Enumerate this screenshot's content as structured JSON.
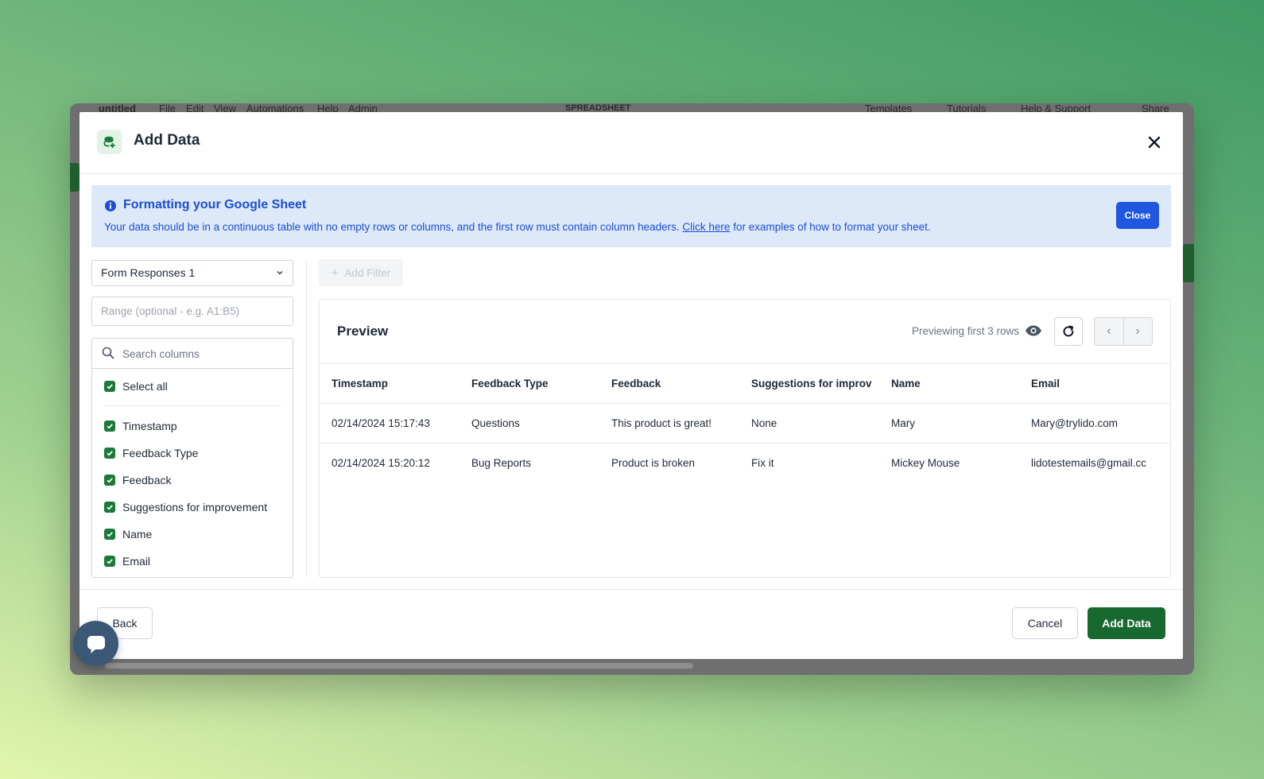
{
  "app": {
    "doc_title": "untitled",
    "menu": [
      "File",
      "Edit",
      "View",
      "Automations",
      "Help",
      "Admin"
    ],
    "mode_label": "SPREADSHEET",
    "right_menu": [
      "Templates",
      "Tutorials",
      "Help & Support",
      "Share"
    ]
  },
  "modal": {
    "title": "Add Data",
    "icon": "database-add-icon",
    "close_icon": "close-icon"
  },
  "banner": {
    "title": "Formatting your Google Sheet",
    "body_before": "Your data should be in a continuous table with no empty rows or columns, and the first row must contain column headers.",
    "link_text": "Click here",
    "body_after": "for examples of how to format your sheet.",
    "close_label": "Close"
  },
  "left_panel": {
    "sheet_value": "Form Responses 1",
    "range_placeholder": "Range (optional - e.g. A1:B5)",
    "search_placeholder": "Search columns",
    "select_all_label": "Select all",
    "columns": [
      "Timestamp",
      "Feedback Type",
      "Feedback",
      "Suggestions for improvement",
      "Name",
      "Email"
    ]
  },
  "filter": {
    "add_filter_label": "Add Filter"
  },
  "preview": {
    "title": "Preview",
    "count_text": "Previewing first 3 rows",
    "headers": [
      "Timestamp",
      "Feedback Type",
      "Feedback",
      "Suggestions for improv",
      "Name",
      "Email"
    ],
    "rows": [
      [
        "02/14/2024 15:17:43",
        "Questions",
        "This product is great!",
        "None",
        "Mary",
        "Mary@trylido.com"
      ],
      [
        "02/14/2024 15:20:12",
        "Bug Reports",
        "Product is broken",
        "Fix it",
        "Mickey Mouse",
        "lidotestemails@gmail.cc"
      ]
    ]
  },
  "footer": {
    "back_label": "Back",
    "cancel_label": "Cancel",
    "add_label": "Add Data"
  },
  "colors": {
    "primary_green": "#17692f",
    "banner_bg": "#dde9f8",
    "banner_text": "#1d4fd0",
    "checkbox": "#1b7a3a"
  }
}
